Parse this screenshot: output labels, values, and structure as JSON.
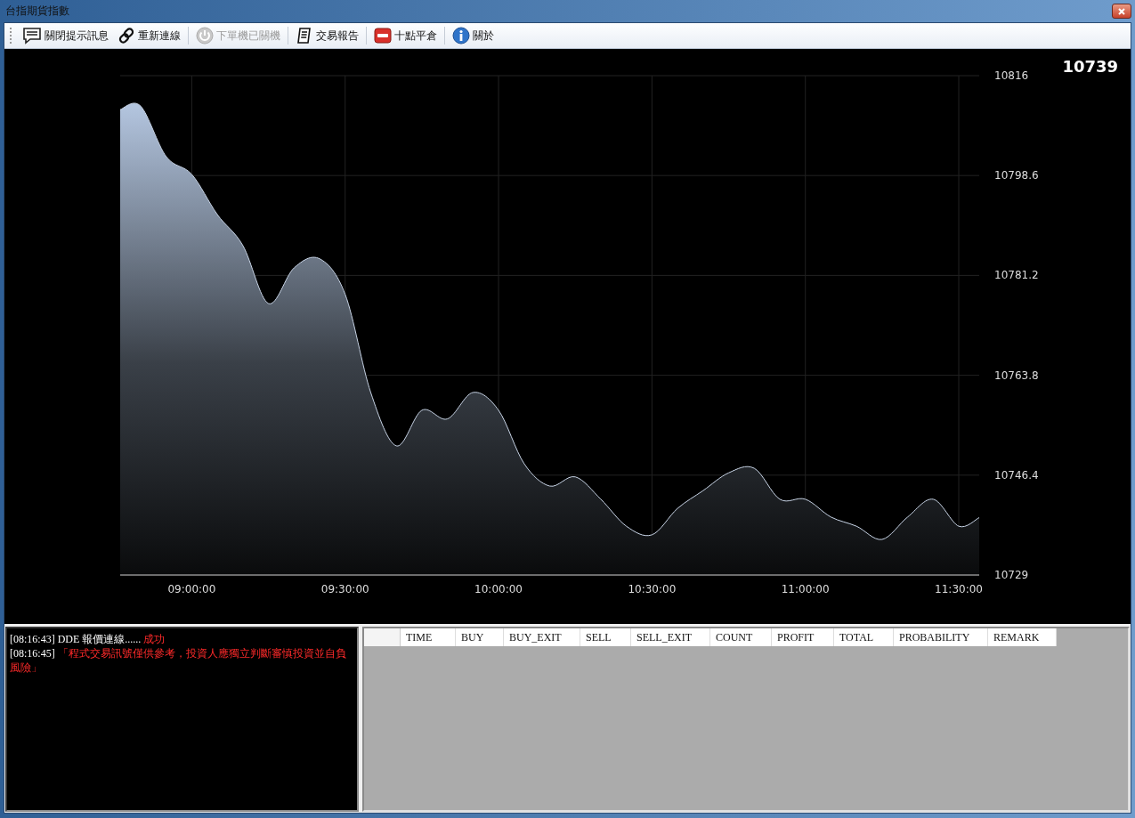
{
  "window": {
    "title": "台指期貨指數"
  },
  "toolbar": [
    {
      "label": "關閉提示訊息",
      "disabled": false
    },
    {
      "label": "重新連線",
      "disabled": false
    },
    {
      "label": "下單機已關機",
      "disabled": true
    },
    {
      "label": "交易報告",
      "disabled": false
    },
    {
      "label": "十點平倉",
      "disabled": false
    },
    {
      "label": "關於",
      "disabled": false
    }
  ],
  "current_price": "10739",
  "chart": {
    "chart_data": {
      "type": "area",
      "x": [
        526,
        530,
        535,
        540,
        545,
        550,
        555,
        560,
        565,
        570,
        575,
        580,
        585,
        590,
        595,
        600,
        605,
        610,
        615,
        620,
        625,
        630,
        635,
        640,
        645,
        650,
        655,
        660,
        665,
        670,
        675,
        680,
        685,
        690,
        694
      ],
      "grid": true,
      "series": [
        {
          "color": "#b4c6e0",
          "values": [
            10810.1,
            10810.7,
            10801.9,
            10798.8,
            10791.8,
            10786.4,
            10776.3,
            10782.5,
            10784.1,
            10777.9,
            10760.8,
            10751.5,
            10757.7,
            10756.2,
            10760.8,
            10757.7,
            10748.4,
            10744.5,
            10746.1,
            10742.2,
            10737.5,
            10736.0,
            10740.6,
            10743.7,
            10746.8,
            10747.6,
            10742.2,
            10742.2,
            10739.1,
            10737.5,
            10735.2,
            10739.1,
            10742.2,
            10737.5,
            10739.0
          ]
        }
      ],
      "xlim": [
        526,
        694
      ],
      "ylim": [
        10729,
        10816
      ],
      "xticks": [
        {
          "value": 540,
          "label": "09:00:00"
        },
        {
          "value": 570,
          "label": "09:30:00"
        },
        {
          "value": 600,
          "label": "10:00:00"
        },
        {
          "value": 630,
          "label": "10:30:00"
        },
        {
          "value": 660,
          "label": "11:00:00"
        },
        {
          "value": 690,
          "label": "11:30:00"
        }
      ],
      "yticks": [
        {
          "value": 10729,
          "label": "10729"
        },
        {
          "value": 10746.4,
          "label": "10746.4"
        },
        {
          "value": 10763.8,
          "label": "10763.8"
        },
        {
          "value": 10781.2,
          "label": "10781.2"
        },
        {
          "value": 10798.6,
          "label": "10798.6"
        },
        {
          "value": 10816,
          "label": "10816"
        }
      ]
    }
  },
  "log": [
    {
      "time": "[08:16:43]",
      "text": "DDE 報價連線......",
      "highlight": "成功"
    },
    {
      "time": "[08:16:45]",
      "highlight": "「程式交易訊號僅供參考，投資人應獨立判斷審慎投資並自負風險」"
    }
  ],
  "table": {
    "columns": [
      "TIME",
      "BUY",
      "BUY_EXIT",
      "SELL",
      "SELL_EXIT",
      "COUNT",
      "PROFIT",
      "TOTAL",
      "PROBABILITY",
      "REMARK"
    ]
  }
}
